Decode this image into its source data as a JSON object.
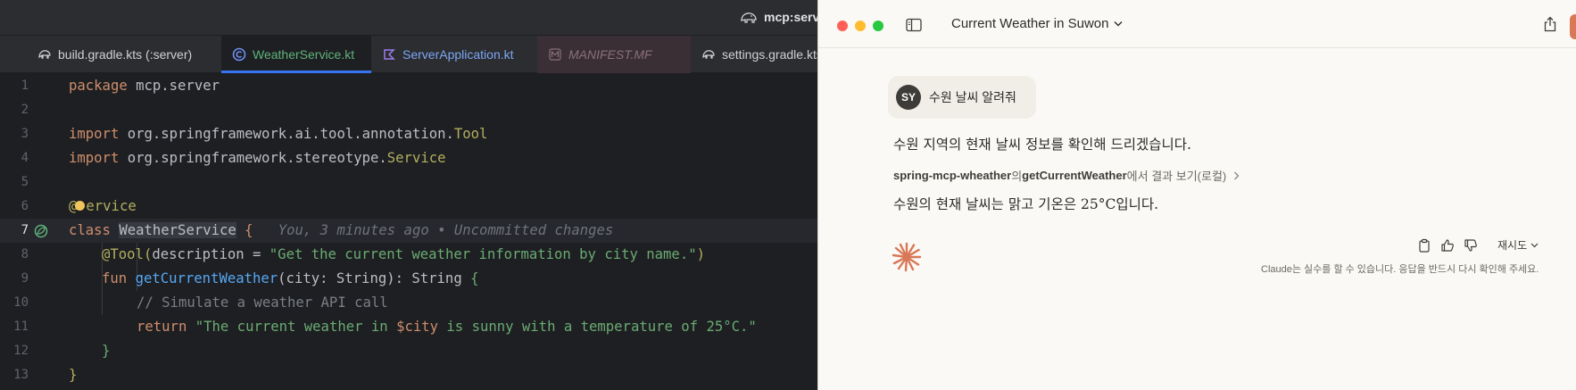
{
  "ide": {
    "window_title": "mcp:server",
    "tabs": [
      {
        "label": "build.gradle.kts (:server)",
        "icon": "gradle-icon"
      },
      {
        "label": "WeatherService.kt",
        "icon": "kotlin-class-icon"
      },
      {
        "label": "ServerApplication.kt",
        "icon": "kotlin-file-icon"
      },
      {
        "label": "MANIFEST.MF",
        "icon": "manifest-icon"
      },
      {
        "label": "settings.gradle.kts",
        "icon": "gradle-icon"
      }
    ],
    "line_numbers": [
      "1",
      "2",
      "3",
      "4",
      "5",
      "6",
      "7",
      "8",
      "9",
      "10",
      "11",
      "12",
      "13"
    ],
    "code": {
      "l1_kw": "package",
      "l1_rest": " mcp.server",
      "l3_kw": "import",
      "l3_pkg": " org.springframework.ai.tool.annotation.",
      "l3_cls": "Tool",
      "l4_kw": "import",
      "l4_pkg": " org.springframework.stereotype.",
      "l4_cls": "Service",
      "l6_ann_a": "@",
      "l6_ann_b": "ervice",
      "l7_kw": "class",
      "l7_name": "WeatherService",
      "l7_brace": " {",
      "l7_inlay": "You, 3 minutes ago • Uncommitted changes",
      "l8_ann": "@Tool",
      "l8_open": "(",
      "l8_param": "description",
      "l8_eq": " = ",
      "l8_str": "\"Get the current weather information by city name.\"",
      "l8_close": ")",
      "l9_kw": "fun",
      "l9_fn": "getCurrentWeather",
      "l9_sig": "(city: String): String ",
      "l9_brace": "{",
      "l10_cmt": "// Simulate a weather API call",
      "l11_kw": "return",
      "l11_str_a": "\"The current weather in ",
      "l11_tpl": "$city",
      "l11_str_b": " is sunny with a temperature of 25°C.\"",
      "l12": "}",
      "l13": "}"
    }
  },
  "claude": {
    "chat_title": "Current Weather in Suwon",
    "user_initials": "SY",
    "user_message": "수원 날씨 알려줘",
    "reply_1": "수원 지역의 현재 날씨 정보를 확인해 드리겠습니다.",
    "tool_server": "spring-mcp-wheather",
    "tool_joiner": "의 ",
    "tool_name": "getCurrentWeather",
    "tool_suffix": "에서 결과 보기(로컬)",
    "reply_2": "수원의 현재 날씨는 맑고 기온은 25°C입니다.",
    "retry_label": "재시도",
    "disclaimer": "Claude는 실수를 할 수 있습니다. 응답을 반드시 다시 확인해 주세요.",
    "colors": {
      "accent": "#d97757",
      "background": "#faf9f5"
    }
  }
}
